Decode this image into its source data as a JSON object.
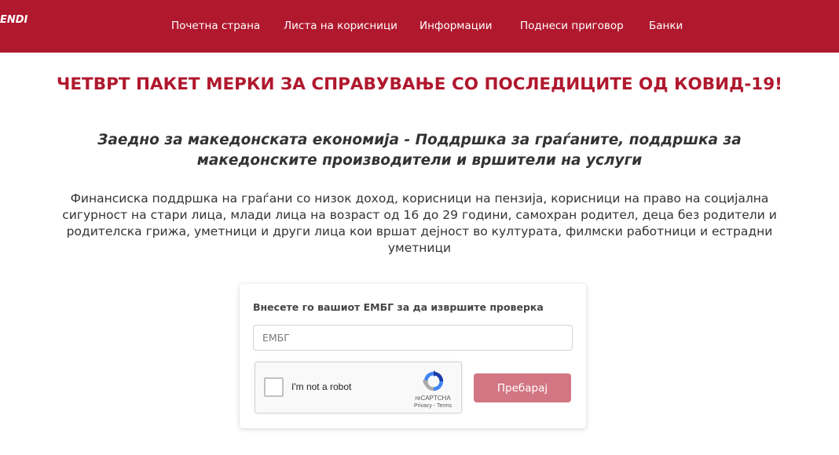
{
  "nav": {
    "logo_text": "ENDI",
    "links": [
      "Почетна страна",
      "Листа на корисници",
      "Информации",
      "Поднеси приговор",
      "Банки"
    ]
  },
  "headline": "ЧЕТВРТ ПАКЕТ МЕРКИ ЗА СПРАВУВАЊЕ СО ПОСЛЕДИЦИТЕ ОД КОВИД-19!",
  "subtitle": "Заедно за македонската економија - Поддршка за граѓаните, поддршка за македонските производители и вршители на услуги",
  "description": "Финансиска поддршка на граѓани со низок доход, корисници на пензија, корисници на право на социјална сигурност на стари лица, млади лица на возраст од 16 до 29 години, самохран родител, деца без родители и родителска грижа, уметници и други лица кои вршат дејност во културата, филмски работници и естрадни уметници",
  "form": {
    "label": "Внесете го вашиот ЕМБГ за да извршите проверка",
    "input_placeholder": "ЕМБГ",
    "input_value": "",
    "submit_label": "Пребарај"
  },
  "recaptcha": {
    "label": "I'm not a robot",
    "brand": "reCAPTCHA",
    "links": "Privacy - Terms",
    "icon": "recaptcha-logo-icon"
  },
  "colors": {
    "brand": "#b0182e",
    "button": "#d27684",
    "text": "#333333"
  }
}
